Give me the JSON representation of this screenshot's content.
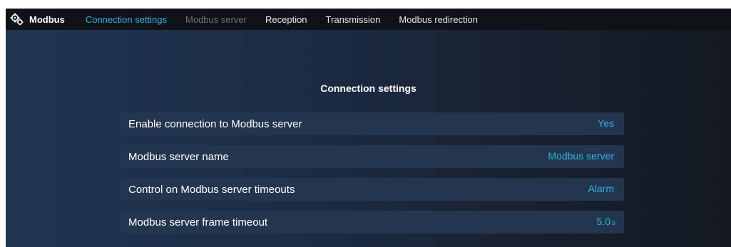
{
  "app": {
    "title": "Modbus",
    "icon": "gear-network-icon"
  },
  "tabs": [
    {
      "label": "Connection settings",
      "state": "active"
    },
    {
      "label": "Modbus server",
      "state": "disabled"
    },
    {
      "label": "Reception",
      "state": "normal"
    },
    {
      "label": "Transmission",
      "state": "normal"
    },
    {
      "label": "Modbus redirection",
      "state": "normal"
    }
  ],
  "section": {
    "title": "Connection settings"
  },
  "settings": [
    {
      "label": "Enable connection to Modbus server",
      "value": "Yes",
      "unit": ""
    },
    {
      "label": "Modbus server name",
      "value": "Modbus server",
      "unit": ""
    },
    {
      "label": "Control on Modbus server timeouts",
      "value": "Alarm",
      "unit": ""
    },
    {
      "label": "Modbus server frame timeout",
      "value": "5.0",
      "unit": "s"
    }
  ],
  "colors": {
    "accent": "#27b6e0",
    "topbar": "#0f1318",
    "row_background": "#24364f"
  }
}
